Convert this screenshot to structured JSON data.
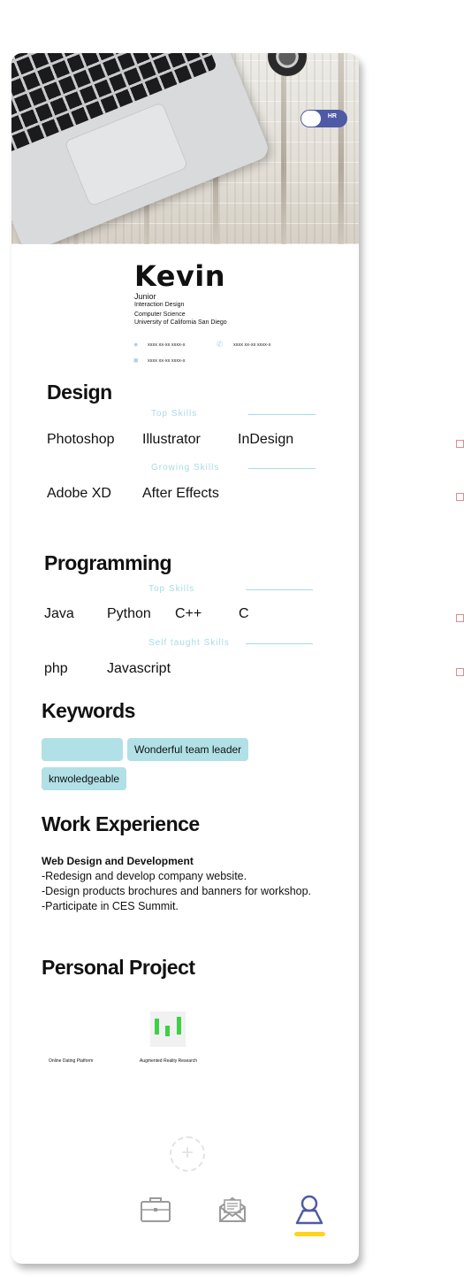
{
  "toggle": {
    "label": "HR"
  },
  "profile": {
    "name": "Kevin",
    "level": "Junior",
    "specialty": "Interaction Design",
    "major": "Computer Science",
    "school": "University of California San Diego",
    "contacts": {
      "location": "xxxx xx-xx xxxx-x",
      "phone": "xxxx xx-xx xxxx-x",
      "email": "xxxx xx-xx xxxx-x"
    }
  },
  "design": {
    "title": "Design",
    "top_label": "Top  Skills",
    "top_skills": [
      "Photoshop",
      "Illustrator",
      "InDesign"
    ],
    "growing_label": "Growing  Skills",
    "growing_skills": [
      "Adobe XD",
      "After Effects"
    ]
  },
  "programming": {
    "title": "Programming",
    "top_label": "Top  Skills",
    "top_skills": [
      "Java",
      "Python",
      "C++",
      "C"
    ],
    "self_label": "Self taught  Skills",
    "self_skills": [
      "php",
      "Javascript"
    ]
  },
  "keywords": {
    "title": "Keywords",
    "chips": [
      "",
      "Wonderful team leader",
      "knwoledgeable"
    ]
  },
  "work": {
    "title": "Work Experience",
    "role": "Web Design and Development",
    "lines": [
      "-Redesign and develop company website.",
      "-Design products brochures and banners for workshop.",
      "-Participate in CES Summit."
    ]
  },
  "projects": {
    "title": "Personal Project",
    "items": [
      "Online Dating Platform",
      "Augmented Reality Research"
    ]
  },
  "nav": {
    "add_symbol": "+",
    "items": [
      "briefcase-icon",
      "mail-icon",
      "profile-icon"
    ],
    "active": "profile-icon"
  },
  "colors": {
    "accent": "#b1e0e6",
    "toggle": "#4f5aa6",
    "nav_active": "#4f5aa6",
    "nav_underline": "#ffd41c",
    "nav_inactive": "#9a9a9a"
  }
}
